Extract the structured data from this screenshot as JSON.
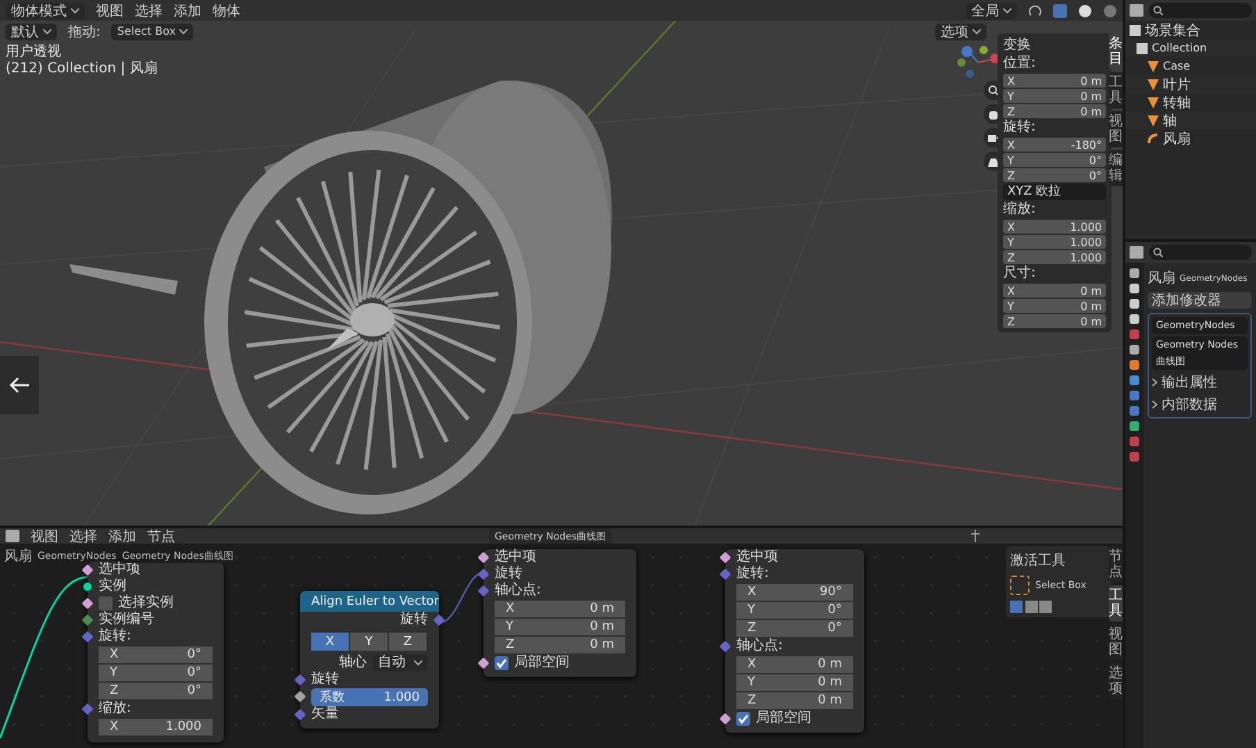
{
  "viewport": {
    "header": {
      "mode": "物体模式",
      "menus": [
        "视图",
        "选择",
        "添加",
        "物体"
      ],
      "orientation": "全局"
    },
    "tool_header": {
      "orientation": "默认",
      "drag_label": "拖动:",
      "drag_value": "Select Box",
      "options": "选项"
    },
    "overlay": {
      "view_name": "用户透视",
      "collection_info": "(212) Collection | 风扇"
    },
    "sidebar": {
      "panel_title": "变换",
      "groups": [
        {
          "label": "位置:",
          "fields": [
            {
              "axis": "X",
              "value": "0 m"
            },
            {
              "axis": "Y",
              "value": "0 m"
            },
            {
              "axis": "Z",
              "value": "0 m"
            }
          ]
        },
        {
          "label": "旋转:",
          "fields": [
            {
              "axis": "X",
              "value": "-180°"
            },
            {
              "axis": "Y",
              "value": "0°"
            },
            {
              "axis": "Z",
              "value": "0°"
            }
          ]
        },
        {
          "label": "缩放:",
          "fields": [
            {
              "axis": "X",
              "value": "1.000"
            },
            {
              "axis": "Y",
              "value": "1.000"
            },
            {
              "axis": "Z",
              "value": "1.000"
            }
          ]
        },
        {
          "label": "尺寸:",
          "fields": [
            {
              "axis": "X",
              "value": "0 m"
            },
            {
              "axis": "Y",
              "value": "0 m"
            },
            {
              "axis": "Z",
              "value": "0 m"
            }
          ]
        }
      ],
      "rotation_mode": "XYZ 欧拉",
      "tabs": [
        {
          "label": "条目",
          "selected": true
        },
        {
          "label": "工具",
          "selected": false
        },
        {
          "label": "视图",
          "selected": false
        },
        {
          "label": "编辑",
          "selected": false
        }
      ]
    }
  },
  "outliner": {
    "root": "场景集合",
    "collection": "Collection",
    "objects": [
      {
        "name": "Case",
        "kind": "mesh"
      },
      {
        "name": "叶片",
        "kind": "mesh"
      },
      {
        "name": "转轴",
        "kind": "mesh"
      },
      {
        "name": "轴",
        "kind": "mesh"
      },
      {
        "name": "风扇",
        "kind": "curve"
      }
    ]
  },
  "properties": {
    "breadcrumb": [
      "风扇",
      "GeometryNodes"
    ],
    "add_modifier": "添加修改器",
    "modifier_name": "GeometryNodes",
    "node_group": "Geometry Nodes曲线图",
    "subpanels": [
      "输出属性",
      "内部数据"
    ]
  },
  "node_editor": {
    "menus": [
      "视图",
      "选择",
      "添加",
      "节点"
    ],
    "node_group": "Geometry Nodes曲线图",
    "breadcrumb": [
      "风扇",
      "GeometryNodes",
      "Geometry Nodes曲线图"
    ],
    "nodes": [
      {
        "rows": [
          {
            "kind": "input",
            "label": "选中项",
            "round_socket": false,
            "color": "#cf9fd6"
          },
          {
            "kind": "input",
            "label": "实例",
            "round_socket": true,
            "color": "#00d6a3"
          },
          {
            "kind": "checkbox",
            "label": "选择实例",
            "checked": false,
            "round_socket": false,
            "color": "#cf9fd6"
          },
          {
            "kind": "input",
            "label": "实例编号",
            "round_socket": false,
            "color": "#4d8c55"
          },
          {
            "kind": "vector",
            "label": "旋转:",
            "round_socket": false,
            "color": "#6464c8",
            "fields": [
              {
                "axis": "X",
                "value": "0°"
              },
              {
                "axis": "Y",
                "value": "0°"
              },
              {
                "axis": "Z",
                "value": "0°"
              }
            ]
          },
          {
            "kind": "vector",
            "label": "缩放:",
            "round_socket": false,
            "color": "#6464c8",
            "fields": [
              {
                "axis": "X",
                "value": "1.000"
              }
            ]
          }
        ]
      },
      {
        "title": "Align Euler to Vector",
        "rows": [
          {
            "kind": "output",
            "label": "旋转",
            "round_socket": false,
            "color": "#6464c8"
          },
          {
            "kind": "enum",
            "options": [
              {
                "label": "X",
                "selected": true
              },
              {
                "label": "Y",
                "selected": false
              },
              {
                "label": "Z",
                "selected": false
              }
            ]
          },
          {
            "kind": "dropdown",
            "label": "轴心",
            "value": "自动"
          },
          {
            "kind": "input",
            "label": "旋转",
            "round_socket": false,
            "color": "#6464c8"
          },
          {
            "kind": "slider",
            "label": "系数",
            "value": "1.000",
            "level": 1,
            "round_socket": false,
            "color": "#a1a1a1"
          },
          {
            "kind": "input",
            "label": "矢量",
            "round_socket": false,
            "color": "#6464c8"
          }
        ]
      },
      {
        "rows": [
          {
            "kind": "input",
            "label": "选中项",
            "round_socket": false,
            "color": "#cf9fd6"
          },
          {
            "kind": "input",
            "label": "旋转",
            "round_socket": false,
            "color": "#6464c8"
          },
          {
            "kind": "vector",
            "label": "轴心点:",
            "round_socket": false,
            "color": "#6464c8",
            "fields": [
              {
                "axis": "X",
                "value": "0 m"
              },
              {
                "axis": "Y",
                "value": "0 m"
              },
              {
                "axis": "Z",
                "value": "0 m"
              }
            ]
          },
          {
            "kind": "checkbox",
            "label": "局部空间",
            "checked": true,
            "round_socket": false,
            "color": "#cf9fd6"
          }
        ]
      },
      {
        "rows": [
          {
            "kind": "input",
            "label": "选中项",
            "round_socket": false,
            "color": "#cf9fd6"
          },
          {
            "kind": "vector",
            "label": "旋转:",
            "round_socket": false,
            "color": "#6464c8",
            "fields": [
              {
                "axis": "X",
                "value": "90°"
              },
              {
                "axis": "Y",
                "value": "0°"
              },
              {
                "axis": "Z",
                "value": "0°"
              }
            ]
          },
          {
            "kind": "vector",
            "label": "轴心点:",
            "round_socket": false,
            "color": "#6464c8",
            "fields": [
              {
                "axis": "X",
                "value": "0 m"
              },
              {
                "axis": "Y",
                "value": "0 m"
              },
              {
                "axis": "Z",
                "value": "0 m"
              }
            ]
          },
          {
            "kind": "checkbox",
            "label": "局部空间",
            "checked": true,
            "round_socket": false,
            "color": "#cf9fd6"
          }
        ]
      }
    ],
    "sidebar": {
      "panel_title": "激活工具",
      "tool": "Select Box",
      "tabs": [
        {
          "label": "节点",
          "selected": false
        },
        {
          "label": "工具",
          "selected": true
        },
        {
          "label": "视图",
          "selected": false
        },
        {
          "label": "选项",
          "selected": false
        }
      ]
    }
  }
}
